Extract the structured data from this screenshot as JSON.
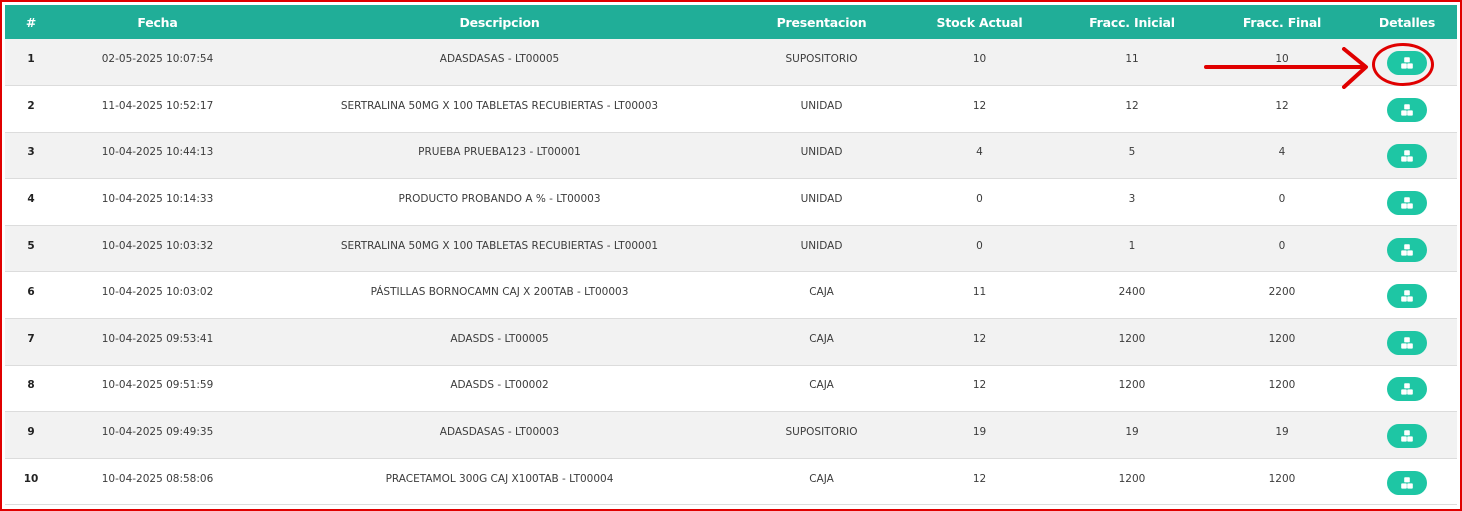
{
  "table": {
    "headers": [
      "#",
      "Fecha",
      "Descripcion",
      "Presentacion",
      "Stock Actual",
      "Fracc. Inicial",
      "Fracc. Final",
      "Detalles"
    ],
    "rows": [
      {
        "num": "1",
        "fecha": "02-05-2025 10:07:54",
        "descripcion": "ADASDASAS - LT00005",
        "presentacion": "SUPOSITORIO",
        "stock": "10",
        "fracc_inicial": "11",
        "fracc_final": "10"
      },
      {
        "num": "2",
        "fecha": "11-04-2025 10:52:17",
        "descripcion": "SERTRALINA 50MG X 100 TABLETAS RECUBIERTAS - LT00003",
        "presentacion": "UNIDAD",
        "stock": "12",
        "fracc_inicial": "12",
        "fracc_final": "12"
      },
      {
        "num": "3",
        "fecha": "10-04-2025 10:44:13",
        "descripcion": "PRUEBA PRUEBA123 - LT00001",
        "presentacion": "UNIDAD",
        "stock": "4",
        "fracc_inicial": "5",
        "fracc_final": "4"
      },
      {
        "num": "4",
        "fecha": "10-04-2025 10:14:33",
        "descripcion": "PRODUCTO PROBANDO A % - LT00003",
        "presentacion": "UNIDAD",
        "stock": "0",
        "fracc_inicial": "3",
        "fracc_final": "0"
      },
      {
        "num": "5",
        "fecha": "10-04-2025 10:03:32",
        "descripcion": "SERTRALINA 50MG X 100 TABLETAS RECUBIERTAS - LT00001",
        "presentacion": "UNIDAD",
        "stock": "0",
        "fracc_inicial": "1",
        "fracc_final": "0"
      },
      {
        "num": "6",
        "fecha": "10-04-2025 10:03:02",
        "descripcion": "PÁSTILLAS BORNOCAMN CAJ X 200TAB - LT00003",
        "presentacion": "CAJA",
        "stock": "11",
        "fracc_inicial": "2400",
        "fracc_final": "2200"
      },
      {
        "num": "7",
        "fecha": "10-04-2025 09:53:41",
        "descripcion": "ADASDS - LT00005",
        "presentacion": "CAJA",
        "stock": "12",
        "fracc_inicial": "1200",
        "fracc_final": "1200"
      },
      {
        "num": "8",
        "fecha": "10-04-2025 09:51:59",
        "descripcion": "ADASDS - LT00002",
        "presentacion": "CAJA",
        "stock": "12",
        "fracc_inicial": "1200",
        "fracc_final": "1200"
      },
      {
        "num": "9",
        "fecha": "10-04-2025 09:49:35",
        "descripcion": "ADASDASAS - LT00003",
        "presentacion": "SUPOSITORIO",
        "stock": "19",
        "fracc_inicial": "19",
        "fracc_final": "19"
      },
      {
        "num": "10",
        "fecha": "10-04-2025 08:58:06",
        "descripcion": "PRACETAMOL 300G CAJ X100TAB - LT00004",
        "presentacion": "CAJA",
        "stock": "12",
        "fracc_inicial": "1200",
        "fracc_final": "1200"
      }
    ],
    "detail_icon": "cubes-icon"
  },
  "colors": {
    "header_bg": "#20ae98",
    "button_bg": "#1ec6a4",
    "annotation": "#e00000"
  }
}
